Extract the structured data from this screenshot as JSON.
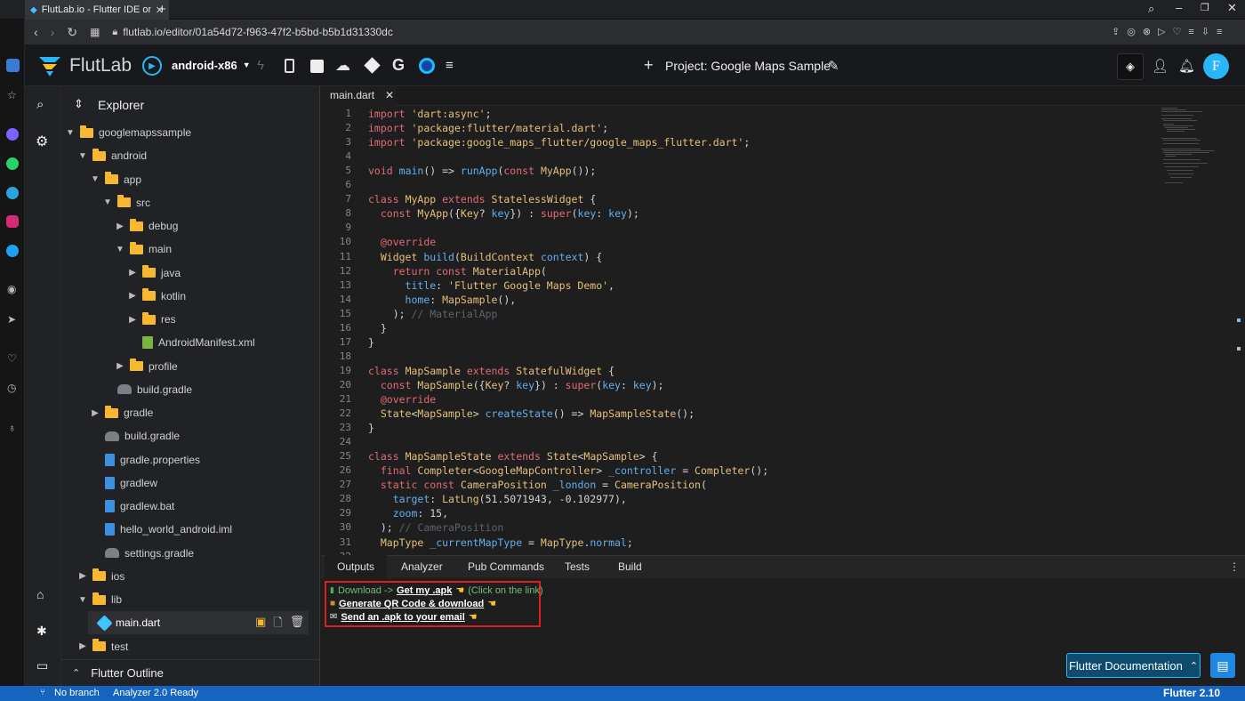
{
  "browser": {
    "tab_title": "FlutLab.io - Flutter IDE onli",
    "url": "flutlab.io/editor/01a54d72-f963-47f2-b5bd-b5b1d31330dc"
  },
  "header": {
    "brand": "FlutLab",
    "device": "android-x86",
    "project_title": "Project: Google Maps Sample",
    "avatar_letter": "F"
  },
  "explorer": {
    "title": "Explorer",
    "items": [
      {
        "label": "googlemapssample",
        "type": "folder",
        "level": 0,
        "caret": "down"
      },
      {
        "label": "android",
        "type": "folder",
        "level": 1,
        "caret": "down"
      },
      {
        "label": "app",
        "type": "folder",
        "level": 2,
        "caret": "down"
      },
      {
        "label": "src",
        "type": "folder",
        "level": 3,
        "caret": "down"
      },
      {
        "label": "debug",
        "type": "folder",
        "level": 4,
        "caret": "right"
      },
      {
        "label": "main",
        "type": "folder",
        "level": 4,
        "caret": "down"
      },
      {
        "label": "java",
        "type": "folder",
        "level": 5,
        "caret": "right"
      },
      {
        "label": "kotlin",
        "type": "folder",
        "level": 5,
        "caret": "right"
      },
      {
        "label": "res",
        "type": "folder",
        "level": 5,
        "caret": "right"
      },
      {
        "label": "AndroidManifest.xml",
        "type": "xml",
        "level": 5,
        "caret": ""
      },
      {
        "label": "profile",
        "type": "folder",
        "level": 4,
        "caret": "right"
      },
      {
        "label": "build.gradle",
        "type": "gradle",
        "level": 3,
        "caret": ""
      },
      {
        "label": "gradle",
        "type": "folder",
        "level": 2,
        "caret": "right"
      },
      {
        "label": "build.gradle",
        "type": "gradle",
        "level": 2,
        "caret": ""
      },
      {
        "label": "gradle.properties",
        "type": "file",
        "level": 2,
        "caret": ""
      },
      {
        "label": "gradlew",
        "type": "file",
        "level": 2,
        "caret": ""
      },
      {
        "label": "gradlew.bat",
        "type": "file",
        "level": 2,
        "caret": ""
      },
      {
        "label": "hello_world_android.iml",
        "type": "file",
        "level": 2,
        "caret": ""
      },
      {
        "label": "settings.gradle",
        "type": "gradle",
        "level": 2,
        "caret": ""
      },
      {
        "label": "ios",
        "type": "folder",
        "level": 1,
        "caret": "right"
      },
      {
        "label": "lib",
        "type": "folder",
        "level": 1,
        "caret": "down"
      },
      {
        "label": "main.dart",
        "type": "dart",
        "level": 2,
        "caret": "",
        "selected": true
      },
      {
        "label": "test",
        "type": "folder",
        "level": 1,
        "caret": "right"
      }
    ],
    "outline_label": "Flutter Outline"
  },
  "editor": {
    "tab_label": "main.dart",
    "lines": [
      "<span class='kw'>import</span> <span class='str'>'dart:async'</span>;",
      "<span class='kw'>import</span> <span class='str'>'package:flutter/material.dart'</span>;",
      "<span class='kw'>import</span> <span class='str'>'package:google_maps_flutter/google_maps_flutter.dart'</span>;",
      "",
      "<span class='kw'>void</span> <span class='prm'>main</span>() => <span class='prm'>runApp</span>(<span class='kw'>const</span> <span class='typ'>MyApp</span>());",
      "",
      "<span class='kw'>class</span> <span class='typ'>MyApp</span> <span class='kw'>extends</span> <span class='typ'>StatelessWidget</span> {",
      "  <span class='kw'>const</span> <span class='typ'>MyApp</span>({<span class='typ'>Key</span>? <span class='prm'>key</span>}) : <span class='kw'>super</span>(<span class='prm'>key</span>: <span class='prm'>key</span>);",
      "",
      "  <span class='ann'>@override</span>",
      "  <span class='typ'>Widget</span> <span class='prm'>build</span>(<span class='typ'>BuildContext</span> <span class='prm'>context</span>) {",
      "    <span class='kw'>return</span> <span class='kw'>const</span> <span class='typ'>MaterialApp</span>(",
      "      <span class='prm'>title</span>: <span class='str'>'Flutter Google Maps Demo'</span>,",
      "      <span class='prm'>home</span>: <span class='typ'>MapSample</span>(),",
      "    ); <span class='cm'>// MaterialApp</span>",
      "  }",
      "}",
      "",
      "<span class='kw'>class</span> <span class='typ'>MapSample</span> <span class='kw'>extends</span> <span class='typ'>StatefulWidget</span> {",
      "  <span class='kw'>const</span> <span class='typ'>MapSample</span>({<span class='typ'>Key</span>? <span class='prm'>key</span>}) : <span class='kw'>super</span>(<span class='prm'>key</span>: <span class='prm'>key</span>);",
      "  <span class='ann'>@override</span>",
      "  <span class='typ'>State</span>&lt;<span class='typ'>MapSample</span>&gt; <span class='prm'>createState</span>() => <span class='typ'>MapSampleState</span>();",
      "}",
      "",
      "<span class='kw'>class</span> <span class='typ'>MapSampleState</span> <span class='kw'>extends</span> <span class='typ'>State</span>&lt;<span class='typ'>MapSample</span>&gt; {",
      "  <span class='kw'>final</span> <span class='typ'>Completer</span>&lt;<span class='typ'>GoogleMapController</span>&gt; <span class='prm'>_controller</span> = <span class='typ'>Completer</span>();",
      "  <span class='kw'>static</span> <span class='kw'>const</span> <span class='typ'>CameraPosition</span> <span class='prm'>_london</span> = <span class='typ'>CameraPosition</span>(",
      "    <span class='prm'>target</span>: <span class='typ'>LatLng</span>(51.5071943, -0.102977),",
      "    <span class='prm'>zoom</span>: 15,",
      "  ); <span class='cm'>// CameraPosition</span>",
      "  <span class='typ'>MapType</span> <span class='prm'>_currentMapType</span> = <span class='typ'>MapType</span>.<span class='prm'>normal</span>;"
    ]
  },
  "panel": {
    "tabs": [
      "Outputs",
      "Analyzer",
      "Pub Commands",
      "Tests",
      "Build"
    ],
    "output": {
      "line1_prefix": "Download ->",
      "line1_link": "Get my .apk",
      "line1_suffix": "(Click on the link)",
      "line2_link": "Generate QR Code & download",
      "line3_link": "Send an .apk to your email"
    }
  },
  "docs_button": "Flutter Documentation",
  "status": {
    "branch": "No branch",
    "analyzer": "Analyzer 2.0 Ready",
    "version": "Flutter 2.10"
  }
}
